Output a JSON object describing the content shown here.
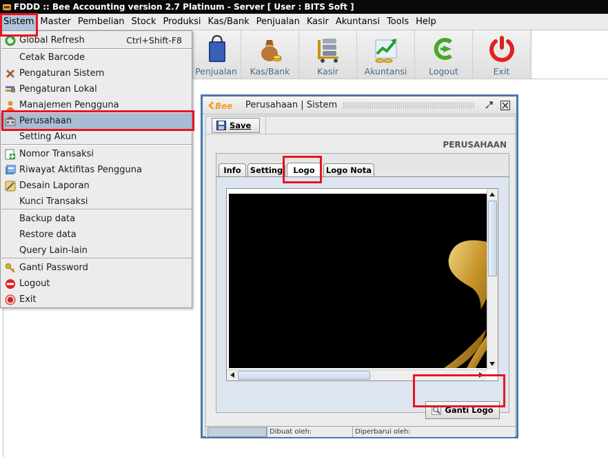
{
  "window": {
    "title": "FDDD :: Bee Accounting version 2.7 Platinum - Server  [ User : BITS Soft ]"
  },
  "menubar": [
    {
      "label": "Sistem",
      "active": true
    },
    {
      "label": "Master"
    },
    {
      "label": "Pembelian"
    },
    {
      "label": "Stock"
    },
    {
      "label": "Produksi"
    },
    {
      "label": "Kas/Bank"
    },
    {
      "label": "Penjualan"
    },
    {
      "label": "Kasir"
    },
    {
      "label": "Akuntansi"
    },
    {
      "label": "Tools"
    },
    {
      "label": "Help"
    }
  ],
  "toolbar": [
    {
      "label": "Penjualan",
      "icon": "shopping-bag-icon"
    },
    {
      "label": "Kas/Bank",
      "icon": "money-bag-icon"
    },
    {
      "label": "Kasir",
      "icon": "cash-register-icon"
    },
    {
      "label": "Akuntansi",
      "icon": "growth-chart-icon"
    },
    {
      "label": "Logout",
      "icon": "logout-arrow-icon"
    },
    {
      "label": "Exit",
      "icon": "power-icon"
    }
  ],
  "sistem_menu": {
    "global_refresh": {
      "label": "Global Refresh",
      "shortcut": "Ctrl+Shift-F8"
    },
    "cetak_barcode": "Cetak Barcode",
    "pengaturan_sistem": "Pengaturan Sistem",
    "pengaturan_lokal": "Pengaturan Lokal",
    "manajemen_pengguna": "Manajemen Pengguna",
    "perusahaan": "Perusahaan",
    "setting_akun": "Setting Akun",
    "nomor_transaksi": "Nomor Transaksi",
    "riwayat_aktifitas": "Riwayat Aktifitas Pengguna",
    "desain_laporan": "Desain Laporan",
    "kunci_transaksi": "Kunci Transaksi",
    "backup_data": "Backup data",
    "restore_data": "Restore data",
    "query_lain": "Query Lain-lain",
    "ganti_password": "Ganti Password",
    "logout": "Logout",
    "exit": "Exit"
  },
  "frame": {
    "logo_text": "Bee",
    "title": "Perusahaan | Sistem",
    "save_label": "Save",
    "heading": "PERUSAHAAN",
    "tabs": [
      "Info",
      "Setting",
      "Logo",
      "Logo Nota"
    ],
    "active_tab": "Logo",
    "ganti_logo_label": "Ganti Logo",
    "status": {
      "dibuat": "Dibuat oleh:",
      "diperbarui": "Diperbarui oleh:"
    }
  }
}
